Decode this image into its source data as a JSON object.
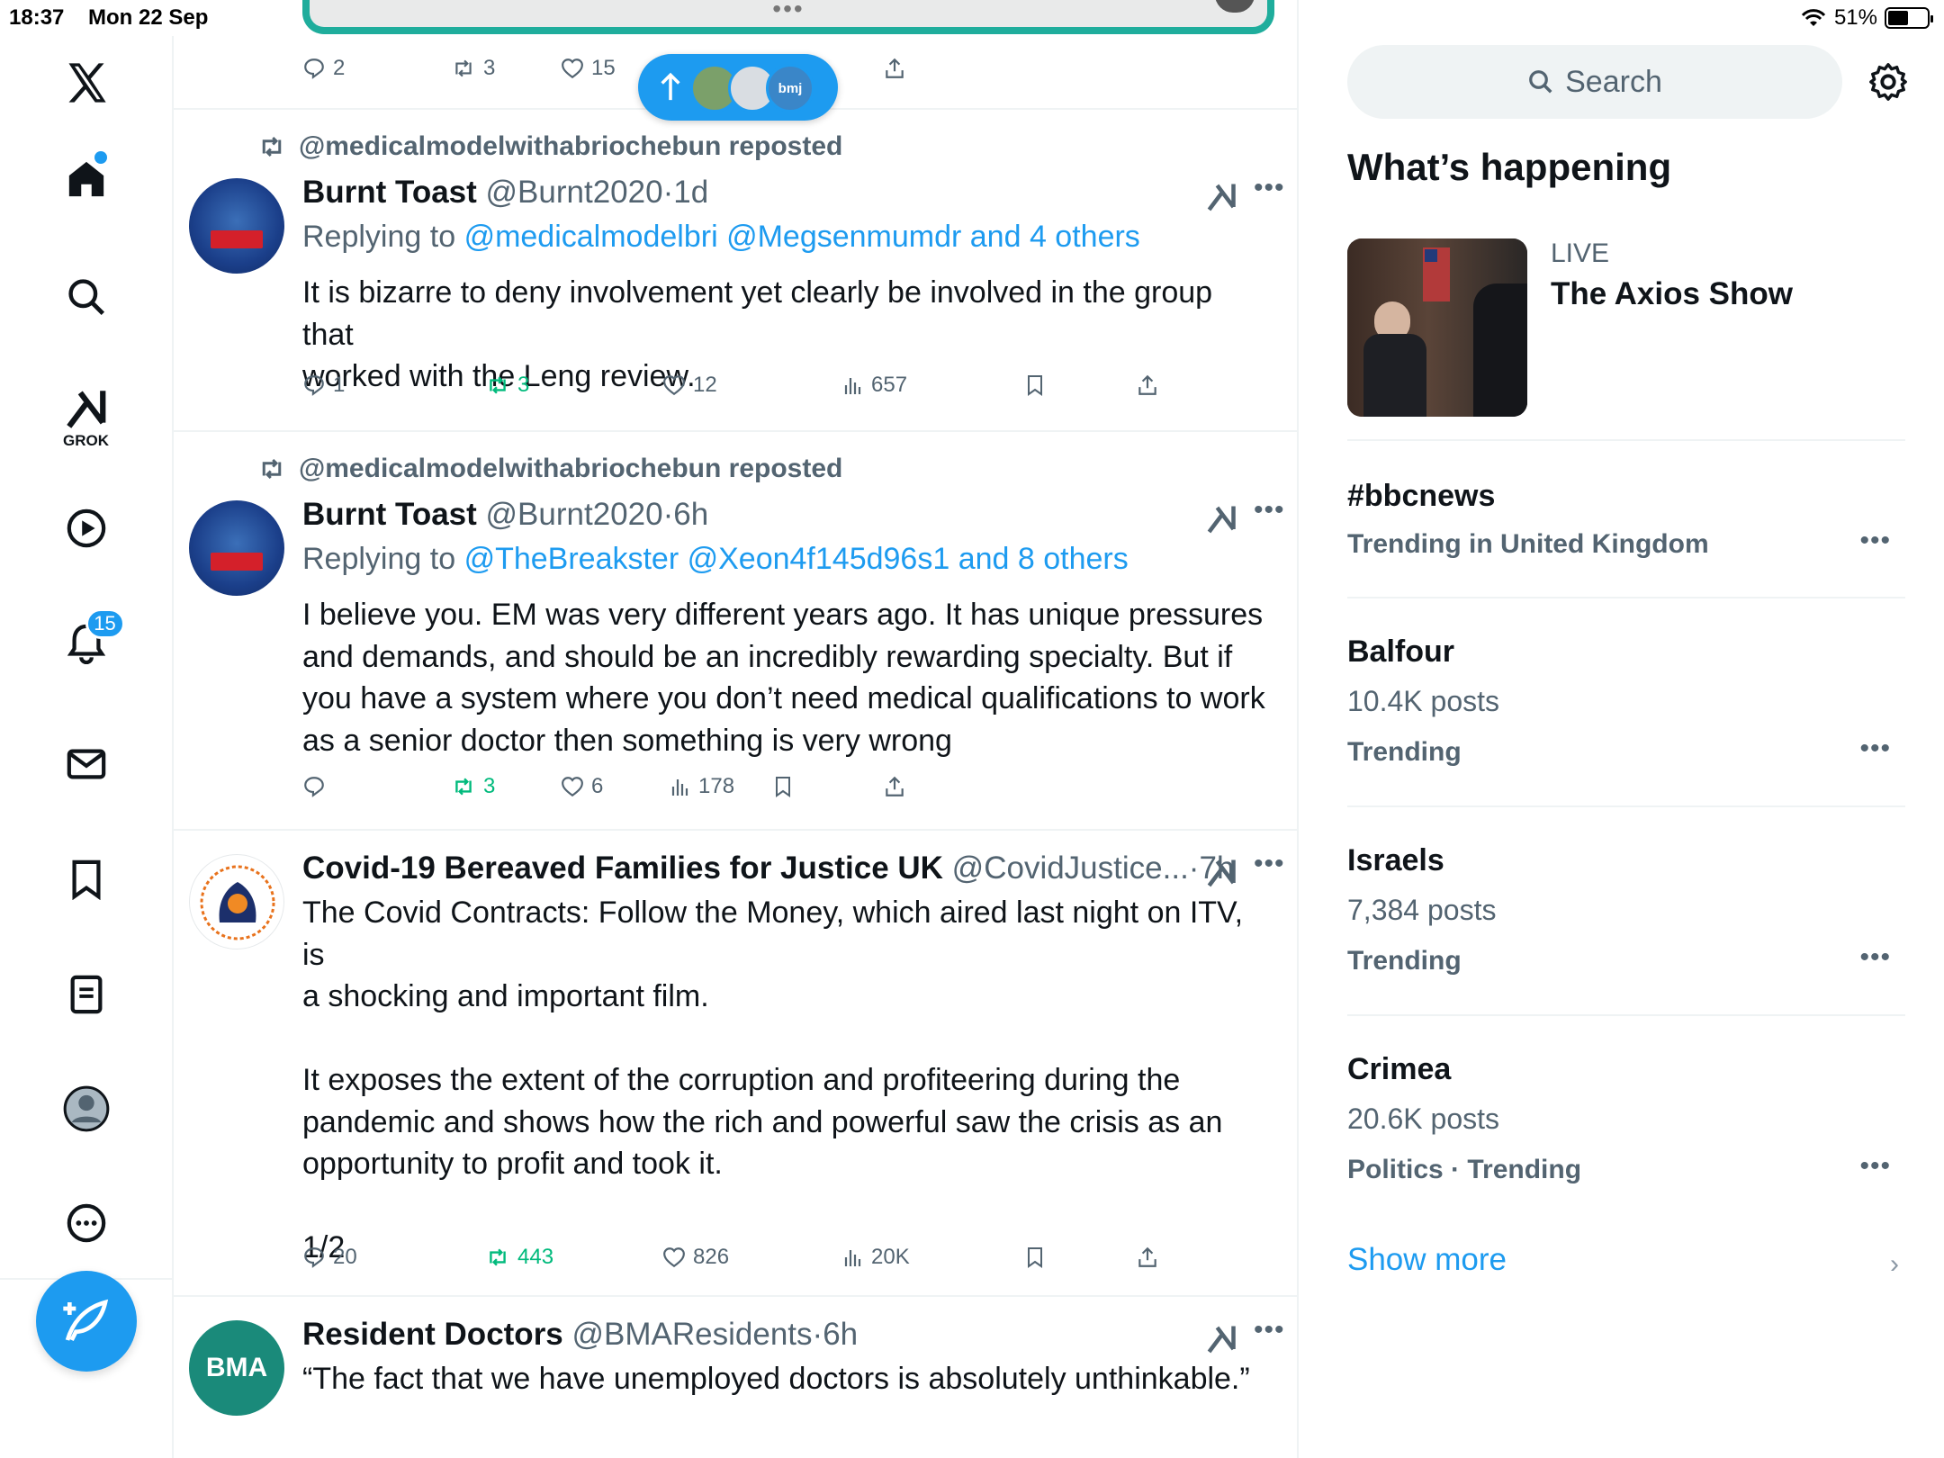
{
  "status_bar": {
    "time": "18:37",
    "date": "Mon 22 Sep",
    "battery": "51%"
  },
  "nav": {
    "grok_label": "GROK",
    "notifications_count": "15",
    "icons": [
      "x-logo-icon",
      "home-icon",
      "search-icon",
      "grok-icon",
      "video-icon",
      "bell-icon",
      "mail-icon",
      "bookmark-icon",
      "lists-icon",
      "profile-icon",
      "more-icon",
      "compose-icon"
    ]
  },
  "top_actions": {
    "replies": "2",
    "reposts": "3",
    "likes": "15"
  },
  "new_posts_pill": {
    "avatar_text": "bmj"
  },
  "tweets": [
    {
      "reposted_by": "@medicalmodelwithabriochebun reposted",
      "name": "Burnt Toast",
      "handle": "@Burnt2020",
      "sep": "·",
      "time": "1d",
      "replying_prefix": "Replying to",
      "replying_links": "@medicalmodelbri @Megsenmumdr and 4 others",
      "text": "It is bizarre to deny involvement yet clearly be involved in the group that\nworked with the Leng review.",
      "replies": "1",
      "reposts": "3",
      "likes": "12",
      "views": "657"
    },
    {
      "reposted_by": "@medicalmodelwithabriochebun reposted",
      "name": "Burnt Toast",
      "handle": "@Burnt2020",
      "sep": "·",
      "time": "6h",
      "replying_prefix": "Replying to",
      "replying_links": "@TheBreakster @Xeon4f145d96s1 and 8 others",
      "text": "I believe you. EM was very different years ago. It has unique pressures\nand demands, and should be an incredibly rewarding specialty. But if\nyou have a system where you don’t need medical qualifications to work\nas a senior doctor then something is very wrong",
      "replies": "",
      "reposts": "3",
      "likes": "6",
      "views": "178"
    },
    {
      "name": "Covid-19 Bereaved Families for Justice UK",
      "handle": "@CovidJustice...",
      "sep": "·",
      "time": "7h",
      "text": "The Covid Contracts: Follow the Money, which aired last night on ITV, is\na shocking and important film.\n\nIt exposes the extent of the corruption and profiteering during the\npandemic and shows how the rich and powerful saw the crisis as an\nopportunity to profit and took it.\n\n1/2",
      "replies": "20",
      "reposts": "443",
      "likes": "826",
      "views": "20K"
    },
    {
      "name": "Resident Doctors",
      "handle": "@BMAResidents",
      "sep": "·",
      "time": "6h",
      "avatar_text": "BMA",
      "text": "“The fact that we have unemployed doctors is absolutely unthinkable.”"
    }
  ],
  "sidebar": {
    "search_placeholder": "Search",
    "title": "What’s happening",
    "live": {
      "label": "LIVE",
      "title": "The Axios Show"
    },
    "trends": [
      {
        "name": "#bbcnews",
        "posts": "",
        "context": "Trending in United Kingdom"
      },
      {
        "name": "Balfour",
        "posts": "10.4K posts",
        "context": "Trending"
      },
      {
        "name": "Israels",
        "posts": "7,384 posts",
        "context": "Trending"
      },
      {
        "name": "Crimea",
        "posts": "20.6K posts",
        "context": "Politics · Trending"
      }
    ],
    "show_more": "Show more"
  },
  "colors": {
    "accent": "#1d9bf0",
    "repost_green": "#00ba7c",
    "muted": "#536471",
    "video_border": "#1fad9c"
  }
}
